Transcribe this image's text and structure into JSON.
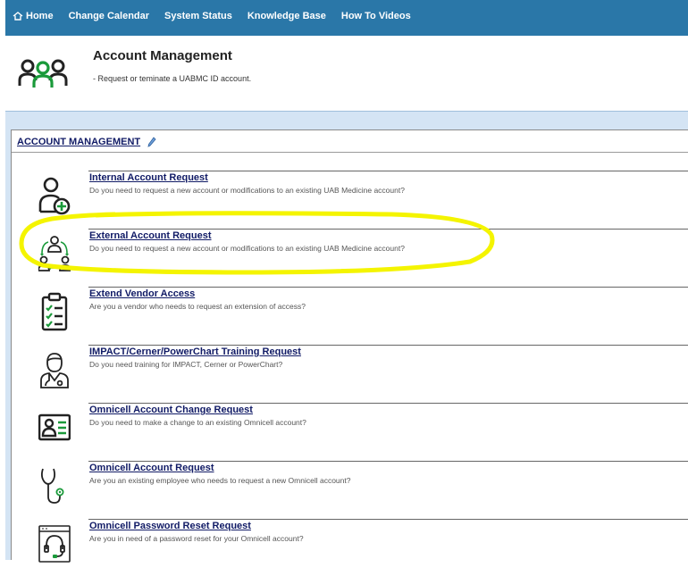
{
  "nav": {
    "items": [
      {
        "label": "Home"
      },
      {
        "label": "Change Calendar"
      },
      {
        "label": "System Status"
      },
      {
        "label": "Knowledge Base"
      },
      {
        "label": "How To Videos"
      }
    ]
  },
  "header": {
    "title": "Account Management",
    "subtitle": "- Request or teminate a UABMC ID account.",
    "icon": "people-group-icon"
  },
  "section": {
    "heading": "ACCOUNT MANAGEMENT",
    "edit_icon": "pencil-icon"
  },
  "items": [
    {
      "title": "Internal Account Request",
      "description": "Do you need to request a new account or modifications to an existing UAB Medicine account?",
      "icon": "add-user-icon"
    },
    {
      "title": "External Account Request",
      "description": "Do you need to request a new account or modifications to an existing UAB Medicine account?",
      "icon": "user-transfer-icon",
      "highlighted": true
    },
    {
      "title": "Extend Vendor Access",
      "description": "Are you a vendor who needs to request an extension of access?",
      "icon": "clipboard-checklist-icon"
    },
    {
      "title": "IMPACT/Cerner/PowerChart Training Request",
      "description": "Do you need training for IMPACT, Cerner or PowerChart?",
      "icon": "doctor-icon"
    },
    {
      "title": "Omnicell Account Change Request",
      "description": "Do you need to make a change to an existing Omnicell account?",
      "icon": "id-card-icon"
    },
    {
      "title": "Omnicell Account Request",
      "description": "Are you an existing employee who needs to request a new Omnicell account?",
      "icon": "stethoscope-icon"
    },
    {
      "title": "Omnicell Password Reset Request",
      "description": "Are you in need of a password reset for your Omnicell account?",
      "icon": "headset-support-icon"
    }
  ],
  "colors": {
    "nav_bg": "#2a77a8",
    "link": "#111b66",
    "band": "#d4e4f4",
    "icon_green": "#1a9a3a",
    "highlight": "#f4f400"
  }
}
